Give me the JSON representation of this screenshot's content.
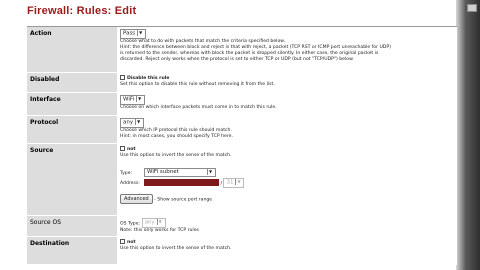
{
  "title": "Firewall: Rules: Edit",
  "rows": {
    "action": {
      "label": "Action",
      "value": "Pass",
      "help": [
        "Choose what to do with packets that match the criteria specified below.",
        "Hint: the difference between block and reject is that with reject, a packet (TCP RST or ICMP port unreachable for UDP)",
        "is returned to the sender, whereas with block the packet is dropped silently. In either case, the original packet is",
        "discarded. Reject only works when the protocol is set to either TCP or UDP (but not \"TCP/UDP\") below."
      ]
    },
    "disabled": {
      "label": "Disabled",
      "checkbox_label": "Disable this rule",
      "help": "Set this option to disable this rule without removing it from the list."
    },
    "interface": {
      "label": "Interface",
      "value": "WiFi",
      "help": "Choose on which interface packets must come in to match this rule."
    },
    "protocol": {
      "label": "Protocol",
      "value": "any",
      "help": [
        "Choose which IP protocol this rule should match.",
        "Hint: in most cases, you should specify TCP here."
      ]
    },
    "source": {
      "label": "Source",
      "not_label": "not",
      "not_help": "Use this option to invert the sense of the match.",
      "type_label": "Type:",
      "type_value": "WiFi subnet",
      "address_label": "Address:",
      "mask_value": "31",
      "advanced_button": "Advanced",
      "advanced_help": "- Show source port range"
    },
    "source_os": {
      "label": "Source OS",
      "os_type_label": "OS Type:",
      "os_type_value": "any",
      "help": "Note: this only works for TCP rules"
    },
    "destination": {
      "label": "Destination",
      "not_label": "not",
      "not_help": "Use this option to invert the sense of the match."
    }
  },
  "colors": {
    "title": "#9a1a1a",
    "label_bg": "#dddddd",
    "redacted_address": "#7d1a1a"
  }
}
